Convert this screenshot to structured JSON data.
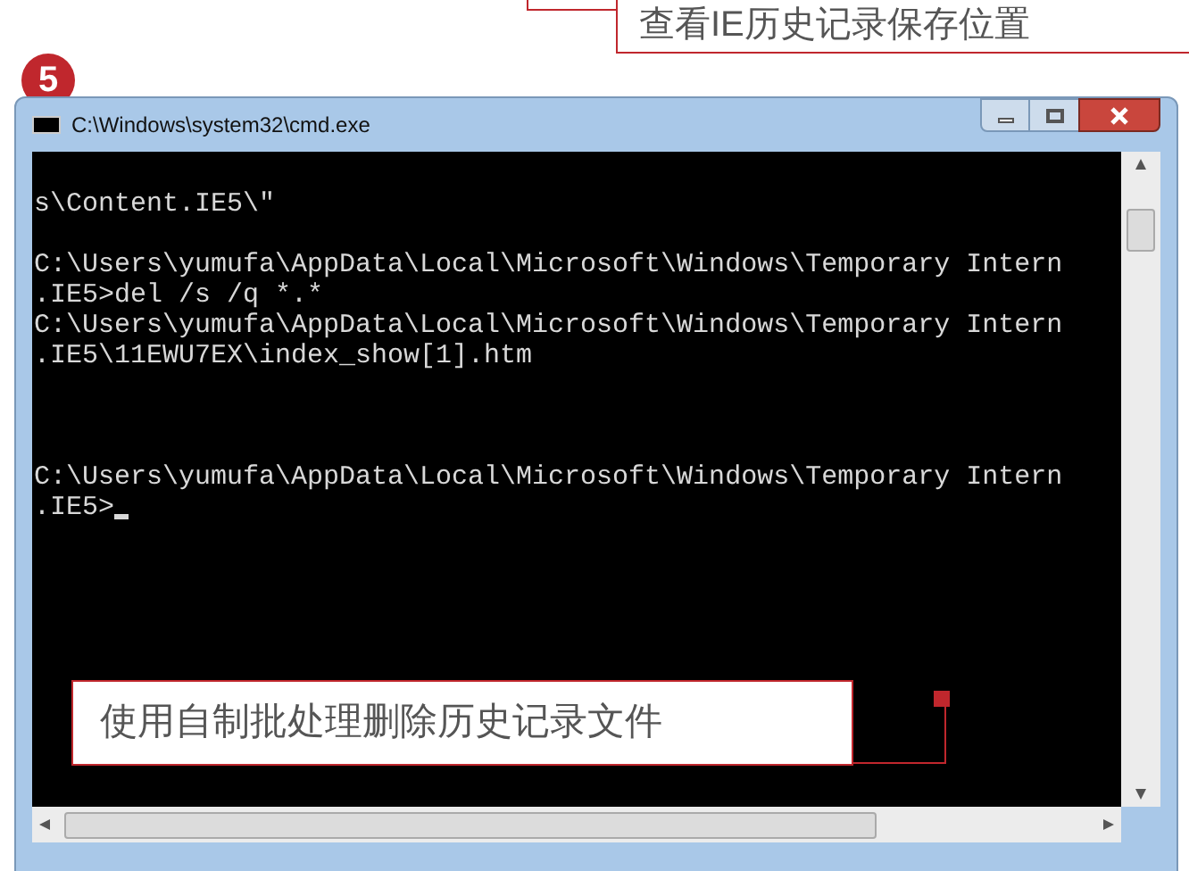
{
  "step_number": "5",
  "top_callout": {
    "text": "查看IE历史记录保存位置"
  },
  "window": {
    "title": "C:\\Windows\\system32\\cmd.exe"
  },
  "console_blocks": [
    [
      "s\\Content.IE5\\\""
    ],
    [
      "C:\\Users\\yumufa\\AppData\\Local\\Microsoft\\Windows\\Temporary Intern",
      ".IE5>del /s /q *.*",
      "C:\\Users\\yumufa\\AppData\\Local\\Microsoft\\Windows\\Temporary Intern",
      ".IE5\\11EWU7EX\\index_show[1].htm"
    ],
    [
      "C:\\Users\\yumufa\\AppData\\Local\\Microsoft\\Windows\\Temporary Intern",
      ".IE5>"
    ]
  ],
  "cursor": {
    "on": true
  },
  "bottom_callout": {
    "text": "使用自制批处理删除历史记录文件"
  }
}
